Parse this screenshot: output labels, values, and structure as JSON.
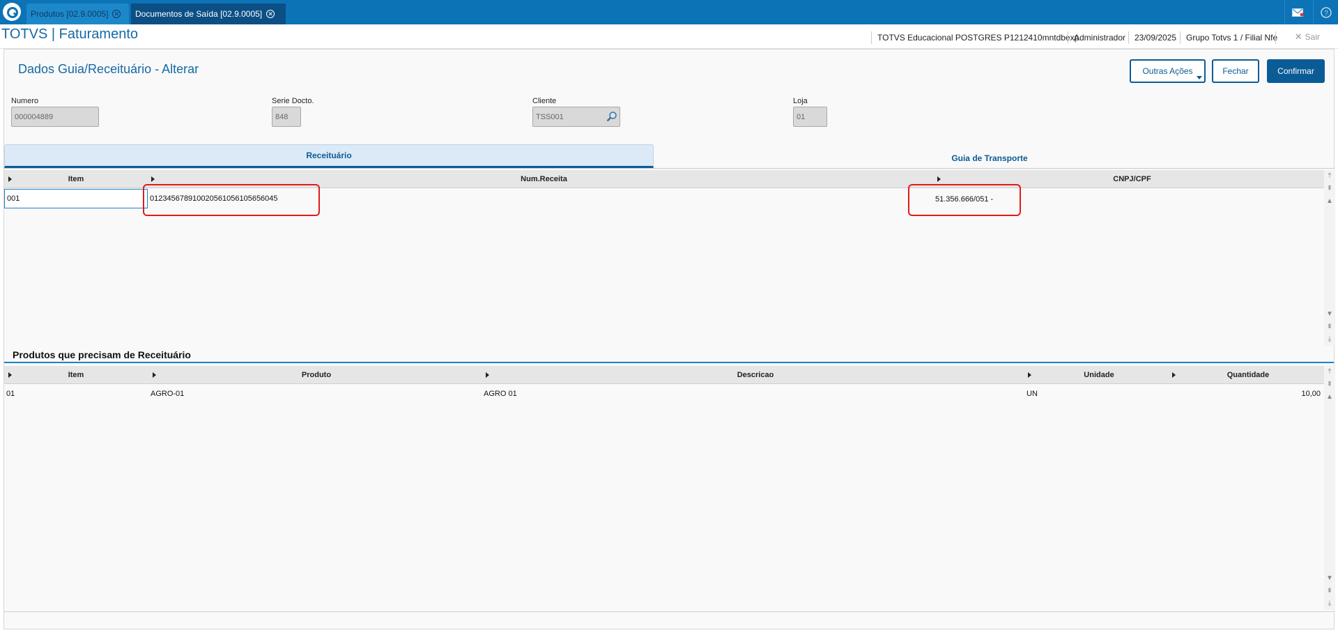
{
  "topbar": {
    "tabs": [
      {
        "label": "Produtos [02.9.0005]",
        "active": false
      },
      {
        "label": "Documentos de Saída [02.9.0005]",
        "active": true
      }
    ],
    "icons": [
      "mail-icon",
      "help-icon"
    ]
  },
  "header": {
    "title": "TOTVS | Faturamento",
    "environment": "TOTVS Educacional POSTGRES P1212410mntdbexp",
    "user": "Administrador",
    "date": "23/09/2025",
    "branch": "Grupo Totvs 1 / Filial Nfe",
    "exit_label": "Sair"
  },
  "page": {
    "title": "Dados Guia/Receituário - Alterar",
    "actions": {
      "other": "Outras Ações",
      "close": "Fechar",
      "confirm": "Confirmar"
    }
  },
  "form": {
    "numero": {
      "label": "Numero",
      "value": "000004889"
    },
    "serie": {
      "label": "Serie Docto.",
      "value": "848"
    },
    "cliente": {
      "label": "Cliente",
      "value": "TSS001"
    },
    "loja": {
      "label": "Loja",
      "value": "01"
    }
  },
  "tabs": [
    "Receituário",
    "Guia de Transporte"
  ],
  "receituario_grid": {
    "columns": [
      "Item",
      "Num.Receita",
      "CNPJ/CPF"
    ],
    "rows": [
      [
        "001",
        "012345678910020561056105656045",
        "51.356.666/051 -"
      ]
    ]
  },
  "products_section": {
    "title": "Produtos que precisam de Receituário",
    "columns": [
      "Item",
      "Produto",
      "Descricao",
      "Unidade",
      "Quantidade"
    ],
    "rows": [
      [
        "01",
        "AGRO-01",
        "AGRO 01",
        "UN",
        "10,00"
      ]
    ]
  },
  "colors": {
    "topbar": "#0c73b6",
    "primary": "#0b5b96",
    "highlight": "#e01b1b"
  }
}
